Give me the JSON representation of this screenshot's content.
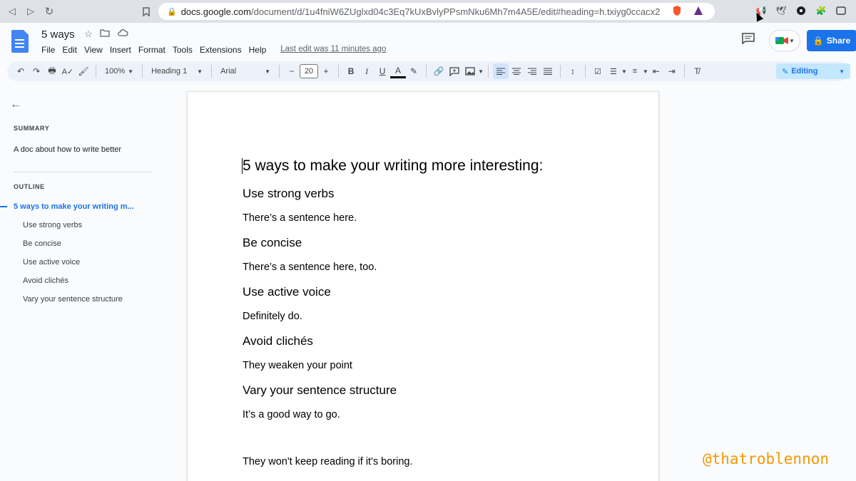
{
  "browser": {
    "url_host": "docs.google.com",
    "url_path": "/document/d/1u4fniW6ZUglxd04c3Eq7kUxBvlyPPsmNku6Mh7m4A5E/edit#heading=h.txiyg0ccacx2"
  },
  "header": {
    "title": "5 ways",
    "menu": [
      "File",
      "Edit",
      "View",
      "Insert",
      "Format",
      "Tools",
      "Extensions",
      "Help"
    ],
    "last_edit": "Last edit was 11 minutes ago",
    "share_label": "Share"
  },
  "toolbar": {
    "zoom": "100%",
    "style": "Heading 1",
    "font": "Arial",
    "font_size": "20",
    "mode": "Editing"
  },
  "sidebar": {
    "summary_label": "SUMMARY",
    "summary_text": "A doc about how to write better",
    "outline_label": "OUTLINE",
    "outline": [
      "5 ways to make your writing m...",
      "Use strong verbs",
      "Be concise",
      "Use active voice",
      "Avoid clichés",
      "Vary your sentence structure"
    ]
  },
  "document": {
    "lines": [
      "5 ways to make your writing more interesting:",
      "Use strong verbs",
      "There’s a sentence here.",
      "Be concise",
      "There’s a sentence here, too.",
      "Use active voice",
      "Definitely do.",
      "Avoid clichés",
      "They weaken your point",
      "Vary your sentence structure",
      "It’s a good way to go.",
      "They won't keep reading if it's boring."
    ]
  },
  "watermark": "@thatroblennon",
  "colors": {
    "accent": "#1a73e8",
    "watermark": "#f29900"
  }
}
